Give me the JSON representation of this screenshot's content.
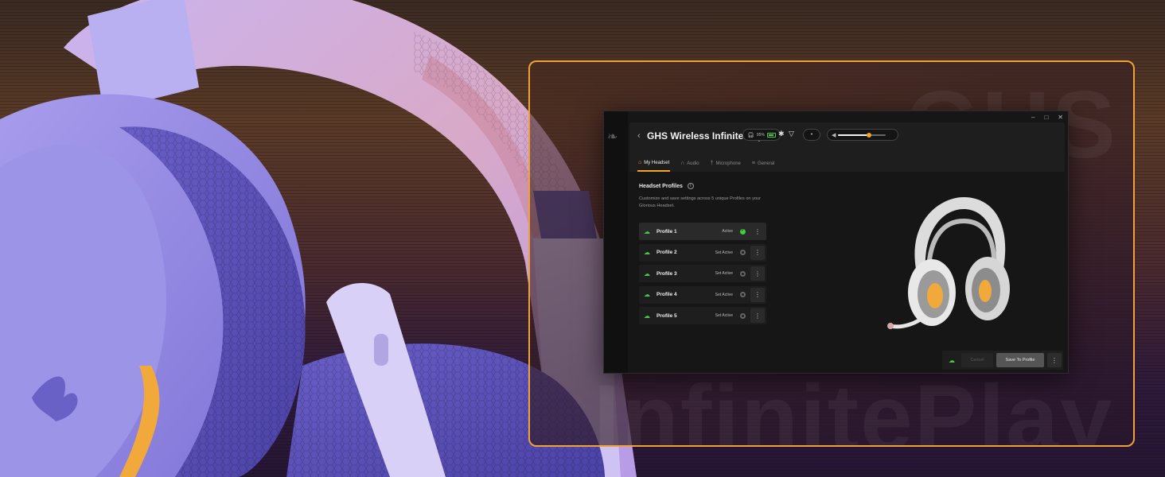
{
  "app": {
    "window_controls": [
      "–",
      "□",
      "✕"
    ],
    "device_name": "GHS Wireless InfinitePlay",
    "battery_percent": "95%",
    "volume_level": 0.65
  },
  "tabs": [
    {
      "label": "My Headset",
      "icon": "home-icon",
      "active": true
    },
    {
      "label": "Audio",
      "icon": "headphones-icon",
      "active": false
    },
    {
      "label": "Microphone",
      "icon": "microphone-icon",
      "active": false
    },
    {
      "label": "General",
      "icon": "sliders-icon",
      "active": false
    }
  ],
  "section": {
    "title": "Headset Profiles",
    "description": "Customize and save settings across 5 unique Profiles on your Glorious Headset."
  },
  "profiles": [
    {
      "name": "Profile 1",
      "status": "Active",
      "active": true
    },
    {
      "name": "Profile 2",
      "status": "Set Active",
      "active": false
    },
    {
      "name": "Profile 3",
      "status": "Set Active",
      "active": false
    },
    {
      "name": "Profile 4",
      "status": "Set Active",
      "active": false
    },
    {
      "name": "Profile 5",
      "status": "Set Active",
      "active": false
    }
  ],
  "footer": {
    "cancel_label": "Cancel",
    "save_label": "Save To Profile"
  },
  "colors": {
    "accent": "#f5a623",
    "success": "#3fcf3f",
    "frame": "#f0a23a"
  }
}
